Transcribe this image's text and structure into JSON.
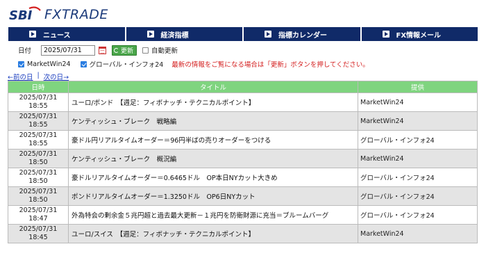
{
  "brand": {
    "logo_text": "FXTRADE",
    "logo_mark": "SBI"
  },
  "nav": {
    "tabs": [
      {
        "label": "ニュース"
      },
      {
        "label": "経済指標"
      },
      {
        "label": "指標カレンダー"
      },
      {
        "label": "FX情報メール"
      }
    ]
  },
  "date_filter": {
    "label": "日付",
    "value": "2025/07/31",
    "update_button": "更新",
    "auto_update_label": "自動更新",
    "auto_update_checked": false
  },
  "sources": [
    {
      "label": "MarketWin24",
      "checked": true
    },
    {
      "label": "グローバル・インフォ24",
      "checked": true
    }
  ],
  "notice": "最新の情報をご覧になる場合は「更新」ボタンを押してください。",
  "pager": {
    "prev": "←前の日",
    "sep": "|",
    "next": "次の日→"
  },
  "table": {
    "headers": [
      "日時",
      "タイトル",
      "提供"
    ],
    "rows": [
      {
        "date": "2025/07/31",
        "time": "18:55",
        "title": "ユーロ/ポンド　【週足：フィボナッチ・テクニカルポイント】",
        "source": "MarketWin24"
      },
      {
        "date": "2025/07/31",
        "time": "18:55",
        "title": "ケンティッシュ・ブレーク　戦略編",
        "source": "MarketWin24"
      },
      {
        "date": "2025/07/31",
        "time": "18:55",
        "title": "豪ドル円リアルタイムオーダー＝96円半ばの売りオーダーをつける",
        "source": "グローバル・インフォ24"
      },
      {
        "date": "2025/07/31",
        "time": "18:50",
        "title": "ケンティッシュ・ブレーク　概況編",
        "source": "MarketWin24"
      },
      {
        "date": "2025/07/31",
        "time": "18:50",
        "title": "豪ドルリアルタイムオーダー＝0.6465ドル　OP本日NYカット大きめ",
        "source": "グローバル・インフォ24"
      },
      {
        "date": "2025/07/31",
        "time": "18:50",
        "title": "ポンドリアルタイムオーダー＝1.3250ドル　OP6日NYカット",
        "source": "グローバル・インフォ24"
      },
      {
        "date": "2025/07/31",
        "time": "18:47",
        "title": "外為特会の剰余金５兆円超と過去最大更新－１兆円を防衛財源に充当＝ブルームバーグ",
        "source": "グローバル・インフォ24"
      },
      {
        "date": "2025/07/31",
        "time": "18:45",
        "title": "ユーロ/スイス　【週足：フィボナッチ・テクニカルポイント】",
        "source": "MarketWin24"
      }
    ]
  }
}
